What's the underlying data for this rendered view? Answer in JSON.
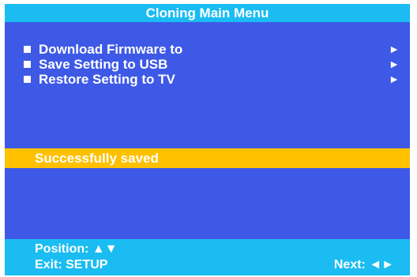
{
  "title": "Cloning Main Menu",
  "menu": {
    "items": [
      {
        "label": "Download Firmware to",
        "arrow": "►"
      },
      {
        "label": "Save Setting to USB",
        "arrow": "►"
      },
      {
        "label": "Restore Setting to TV",
        "arrow": "►"
      }
    ]
  },
  "status": {
    "message": "Successfully saved"
  },
  "footer": {
    "position_label": "Position: ▲▼",
    "exit_label": "Exit: SETUP",
    "next_label": "Next: ◄►"
  },
  "colors": {
    "background": "#3d59e6",
    "title_bar": "#1abcf2",
    "status_bar": "#ffc000",
    "footer_bar": "#1abcf2",
    "text": "#ffffff"
  }
}
